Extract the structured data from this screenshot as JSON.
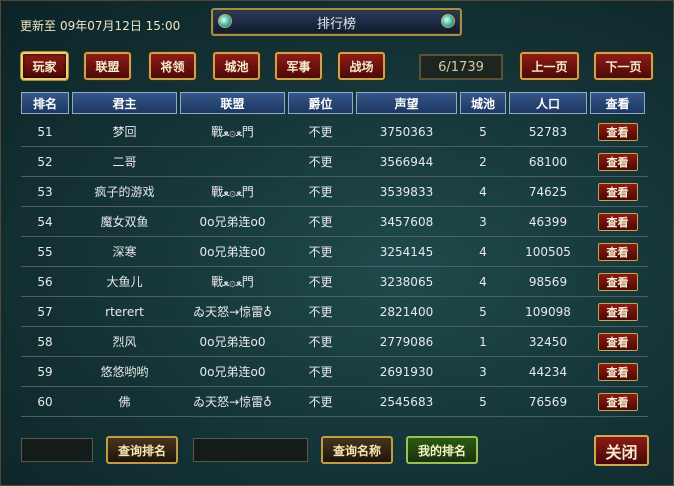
{
  "header": {
    "update_label": "更新至",
    "update_time": "09年07月12日 15:00",
    "title": "排行榜"
  },
  "tabs": [
    {
      "label": "玩家",
      "active": true
    },
    {
      "label": "联盟",
      "active": false
    },
    {
      "label": "将领",
      "active": false
    },
    {
      "label": "城池",
      "active": false
    },
    {
      "label": "军事",
      "active": false
    },
    {
      "label": "战场",
      "active": false
    }
  ],
  "pagination": {
    "indicator": "6/1739",
    "prev_label": "上一页",
    "next_label": "下一页"
  },
  "table": {
    "columns": [
      "排名",
      "君主",
      "联盟",
      "爵位",
      "声望",
      "城池",
      "人口",
      "查看"
    ],
    "view_label": "查看",
    "rows": [
      {
        "rank": "51",
        "lord": "梦回",
        "alliance": "戰ﻌ۞ﻌ門",
        "title": "不更",
        "prestige": "3750363",
        "cities": "5",
        "population": "52783"
      },
      {
        "rank": "52",
        "lord": "二哥",
        "alliance": "",
        "title": "不更",
        "prestige": "3566944",
        "cities": "2",
        "population": "68100"
      },
      {
        "rank": "53",
        "lord": "疯子的游戏",
        "alliance": "戰ﻌ۞ﻌ門",
        "title": "不更",
        "prestige": "3539833",
        "cities": "4",
        "population": "74625"
      },
      {
        "rank": "54",
        "lord": "魔女双鱼",
        "alliance": "0o兄弟连o0",
        "title": "不更",
        "prestige": "3457608",
        "cities": "3",
        "population": "46399"
      },
      {
        "rank": "55",
        "lord": "深寒",
        "alliance": "0o兄弟连o0",
        "title": "不更",
        "prestige": "3254145",
        "cities": "4",
        "population": "100505"
      },
      {
        "rank": "56",
        "lord": "大鱼儿",
        "alliance": "戰ﻌ۞ﻌ門",
        "title": "不更",
        "prestige": "3238065",
        "cities": "4",
        "population": "98569"
      },
      {
        "rank": "57",
        "lord": "rterert",
        "alliance": "ゐ天怒→惊雷♁",
        "title": "不更",
        "prestige": "2821400",
        "cities": "5",
        "population": "109098"
      },
      {
        "rank": "58",
        "lord": "烈风",
        "alliance": "0o兄弟连o0",
        "title": "不更",
        "prestige": "2779086",
        "cities": "1",
        "population": "32450"
      },
      {
        "rank": "59",
        "lord": "悠悠哟哟",
        "alliance": "0o兄弟连o0",
        "title": "不更",
        "prestige": "2691930",
        "cities": "3",
        "population": "44234"
      },
      {
        "rank": "60",
        "lord": "佛",
        "alliance": "ゐ天怒→惊雷♁",
        "title": "不更",
        "prestige": "2545683",
        "cities": "5",
        "population": "76569"
      }
    ]
  },
  "footer": {
    "rank_input_value": "",
    "query_rank_label": "查询排名",
    "name_input_value": "",
    "query_name_label": "查询名称",
    "my_rank_label": "我的排名",
    "close_label": "关闭"
  }
}
